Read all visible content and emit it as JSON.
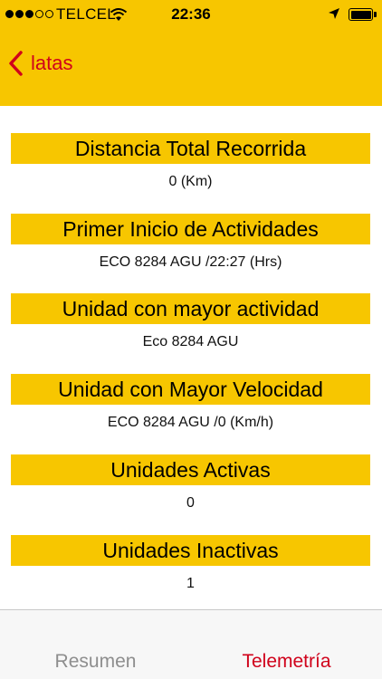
{
  "status_bar": {
    "carrier": "TELCEL",
    "time": "22:36",
    "signal_bars_filled": 3,
    "signal_bars_total": 5
  },
  "nav": {
    "back_label": "latas",
    "accent_color": "#d0021b",
    "bar_color": "#f7c600"
  },
  "sections": [
    {
      "title": "Distancia Total Recorrida",
      "value": "0 (Km)"
    },
    {
      "title": "Primer Inicio de Actividades",
      "value": "ECO 8284 AGU /22:27 (Hrs)"
    },
    {
      "title": "Unidad con mayor actividad",
      "value": "Eco 8284 AGU"
    },
    {
      "title": "Unidad con Mayor Velocidad",
      "value": "ECO 8284 AGU /0 (Km/h)"
    },
    {
      "title": "Unidades Activas",
      "value": "0"
    },
    {
      "title": "Unidades Inactivas",
      "value": "1"
    }
  ],
  "tabs": [
    {
      "label": "Resumen",
      "active": false
    },
    {
      "label": "Telemetría",
      "active": true
    }
  ]
}
